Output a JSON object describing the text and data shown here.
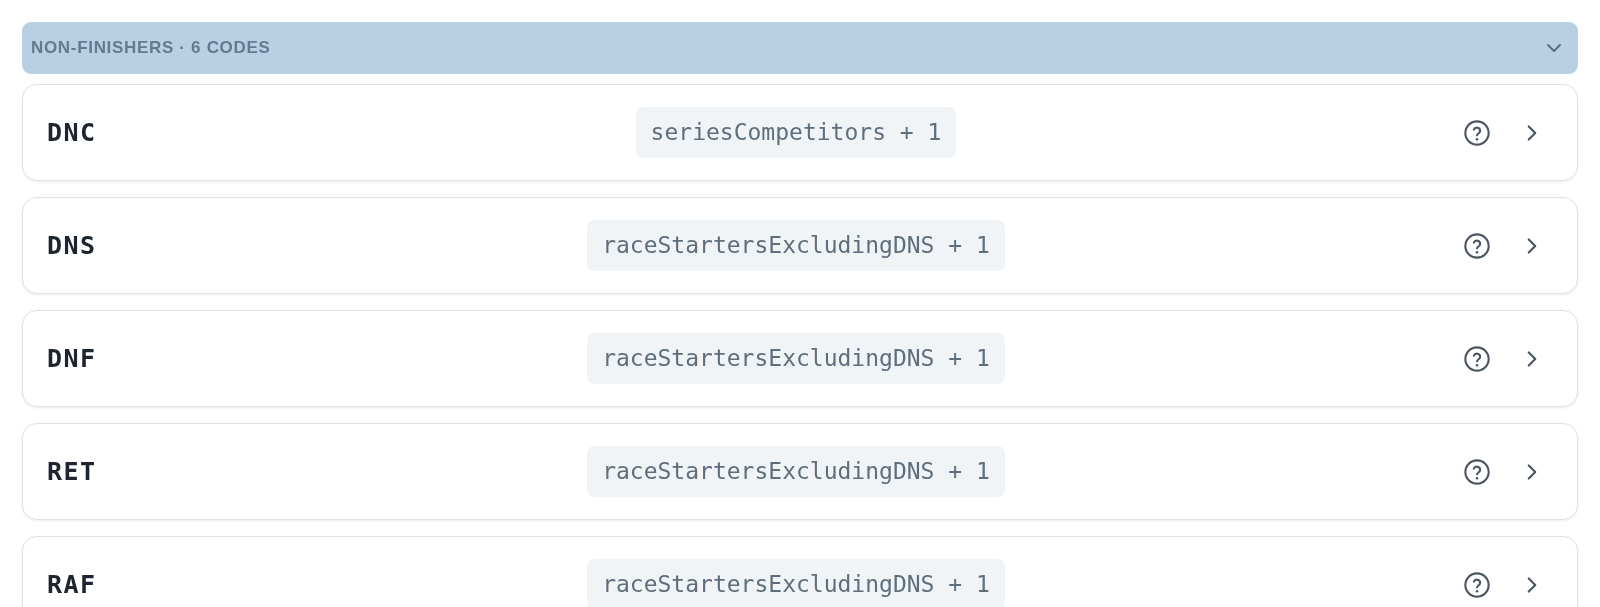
{
  "header": {
    "title": "NON-FINISHERS · 6 CODES",
    "expanded": true
  },
  "codes": [
    {
      "code": "DNC",
      "formula": "seriesCompetitors + 1"
    },
    {
      "code": "DNS",
      "formula": "raceStartersExcludingDNS + 1"
    },
    {
      "code": "DNF",
      "formula": "raceStartersExcludingDNS + 1"
    },
    {
      "code": "RET",
      "formula": "raceStartersExcludingDNS + 1"
    },
    {
      "code": "RAF",
      "formula": "raceStartersExcludingDNS + 1"
    }
  ]
}
